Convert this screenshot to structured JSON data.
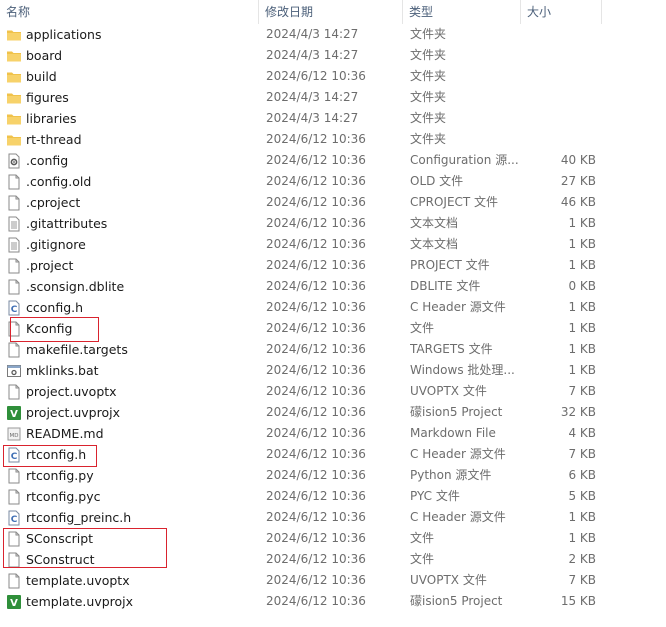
{
  "columns": {
    "name": "名称",
    "date": "修改日期",
    "type": "类型",
    "size": "大小"
  },
  "rows": [
    {
      "name": "applications",
      "date": "2024/4/3 14:27",
      "type": "文件夹",
      "size": "",
      "icon": "folder-icon"
    },
    {
      "name": "board",
      "date": "2024/4/3 14:27",
      "type": "文件夹",
      "size": "",
      "icon": "folder-icon"
    },
    {
      "name": "build",
      "date": "2024/6/12 10:36",
      "type": "文件夹",
      "size": "",
      "icon": "folder-icon"
    },
    {
      "name": "figures",
      "date": "2024/4/3 14:27",
      "type": "文件夹",
      "size": "",
      "icon": "folder-icon"
    },
    {
      "name": "libraries",
      "date": "2024/4/3 14:27",
      "type": "文件夹",
      "size": "",
      "icon": "folder-icon"
    },
    {
      "name": "rt-thread",
      "date": "2024/6/12 10:36",
      "type": "文件夹",
      "size": "",
      "icon": "folder-icon"
    },
    {
      "name": ".config",
      "date": "2024/6/12 10:36",
      "type": "Configuration 源...",
      "size": "40 KB",
      "icon": "settings-file-icon"
    },
    {
      "name": ".config.old",
      "date": "2024/6/12 10:36",
      "type": "OLD 文件",
      "size": "27 KB",
      "icon": "file-icon"
    },
    {
      "name": ".cproject",
      "date": "2024/6/12 10:36",
      "type": "CPROJECT 文件",
      "size": "46 KB",
      "icon": "file-icon"
    },
    {
      "name": ".gitattributes",
      "date": "2024/6/12 10:36",
      "type": "文本文档",
      "size": "1 KB",
      "icon": "text-file-icon"
    },
    {
      "name": ".gitignore",
      "date": "2024/6/12 10:36",
      "type": "文本文档",
      "size": "1 KB",
      "icon": "text-file-icon"
    },
    {
      "name": ".project",
      "date": "2024/6/12 10:36",
      "type": "PROJECT 文件",
      "size": "1 KB",
      "icon": "file-icon"
    },
    {
      "name": ".sconsign.dblite",
      "date": "2024/6/12 10:36",
      "type": "DBLITE 文件",
      "size": "0 KB",
      "icon": "file-icon"
    },
    {
      "name": "cconfig.h",
      "date": "2024/6/12 10:36",
      "type": "C Header 源文件",
      "size": "1 KB",
      "icon": "c-header-icon"
    },
    {
      "name": "Kconfig",
      "date": "2024/6/12 10:36",
      "type": "文件",
      "size": "1 KB",
      "icon": "file-icon"
    },
    {
      "name": "makefile.targets",
      "date": "2024/6/12 10:36",
      "type": "TARGETS 文件",
      "size": "1 KB",
      "icon": "file-icon"
    },
    {
      "name": "mklinks.bat",
      "date": "2024/6/12 10:36",
      "type": "Windows 批处理...",
      "size": "1 KB",
      "icon": "batch-file-icon"
    },
    {
      "name": "project.uvoptx",
      "date": "2024/6/12 10:36",
      "type": "UVOPTX 文件",
      "size": "7 KB",
      "icon": "file-icon"
    },
    {
      "name": "project.uvprojx",
      "date": "2024/6/12 10:36",
      "type": "礞ision5 Project",
      "size": "32 KB",
      "icon": "keil-project-icon"
    },
    {
      "name": "README.md",
      "date": "2024/6/12 10:36",
      "type": "Markdown File",
      "size": "4 KB",
      "icon": "markdown-file-icon"
    },
    {
      "name": "rtconfig.h",
      "date": "2024/6/12 10:36",
      "type": "C Header 源文件",
      "size": "7 KB",
      "icon": "c-header-icon"
    },
    {
      "name": "rtconfig.py",
      "date": "2024/6/12 10:36",
      "type": "Python 源文件",
      "size": "6 KB",
      "icon": "file-icon"
    },
    {
      "name": "rtconfig.pyc",
      "date": "2024/6/12 10:36",
      "type": "PYC 文件",
      "size": "5 KB",
      "icon": "file-icon"
    },
    {
      "name": "rtconfig_preinc.h",
      "date": "2024/6/12 10:36",
      "type": "C Header 源文件",
      "size": "1 KB",
      "icon": "c-header-icon"
    },
    {
      "name": "SConscript",
      "date": "2024/6/12 10:36",
      "type": "文件",
      "size": "1 KB",
      "icon": "file-icon"
    },
    {
      "name": "SConstruct",
      "date": "2024/6/12 10:36",
      "type": "文件",
      "size": "2 KB",
      "icon": "file-icon"
    },
    {
      "name": "template.uvoptx",
      "date": "2024/6/12 10:36",
      "type": "UVOPTX 文件",
      "size": "7 KB",
      "icon": "file-icon"
    },
    {
      "name": "template.uvprojx",
      "date": "2024/6/12 10:36",
      "type": "礞ision5 Project",
      "size": "15 KB",
      "icon": "keil-project-icon"
    }
  ],
  "colors": {
    "highlight": "#d9232e",
    "folder": "#f0c24a",
    "header_text": "#4c607a"
  }
}
